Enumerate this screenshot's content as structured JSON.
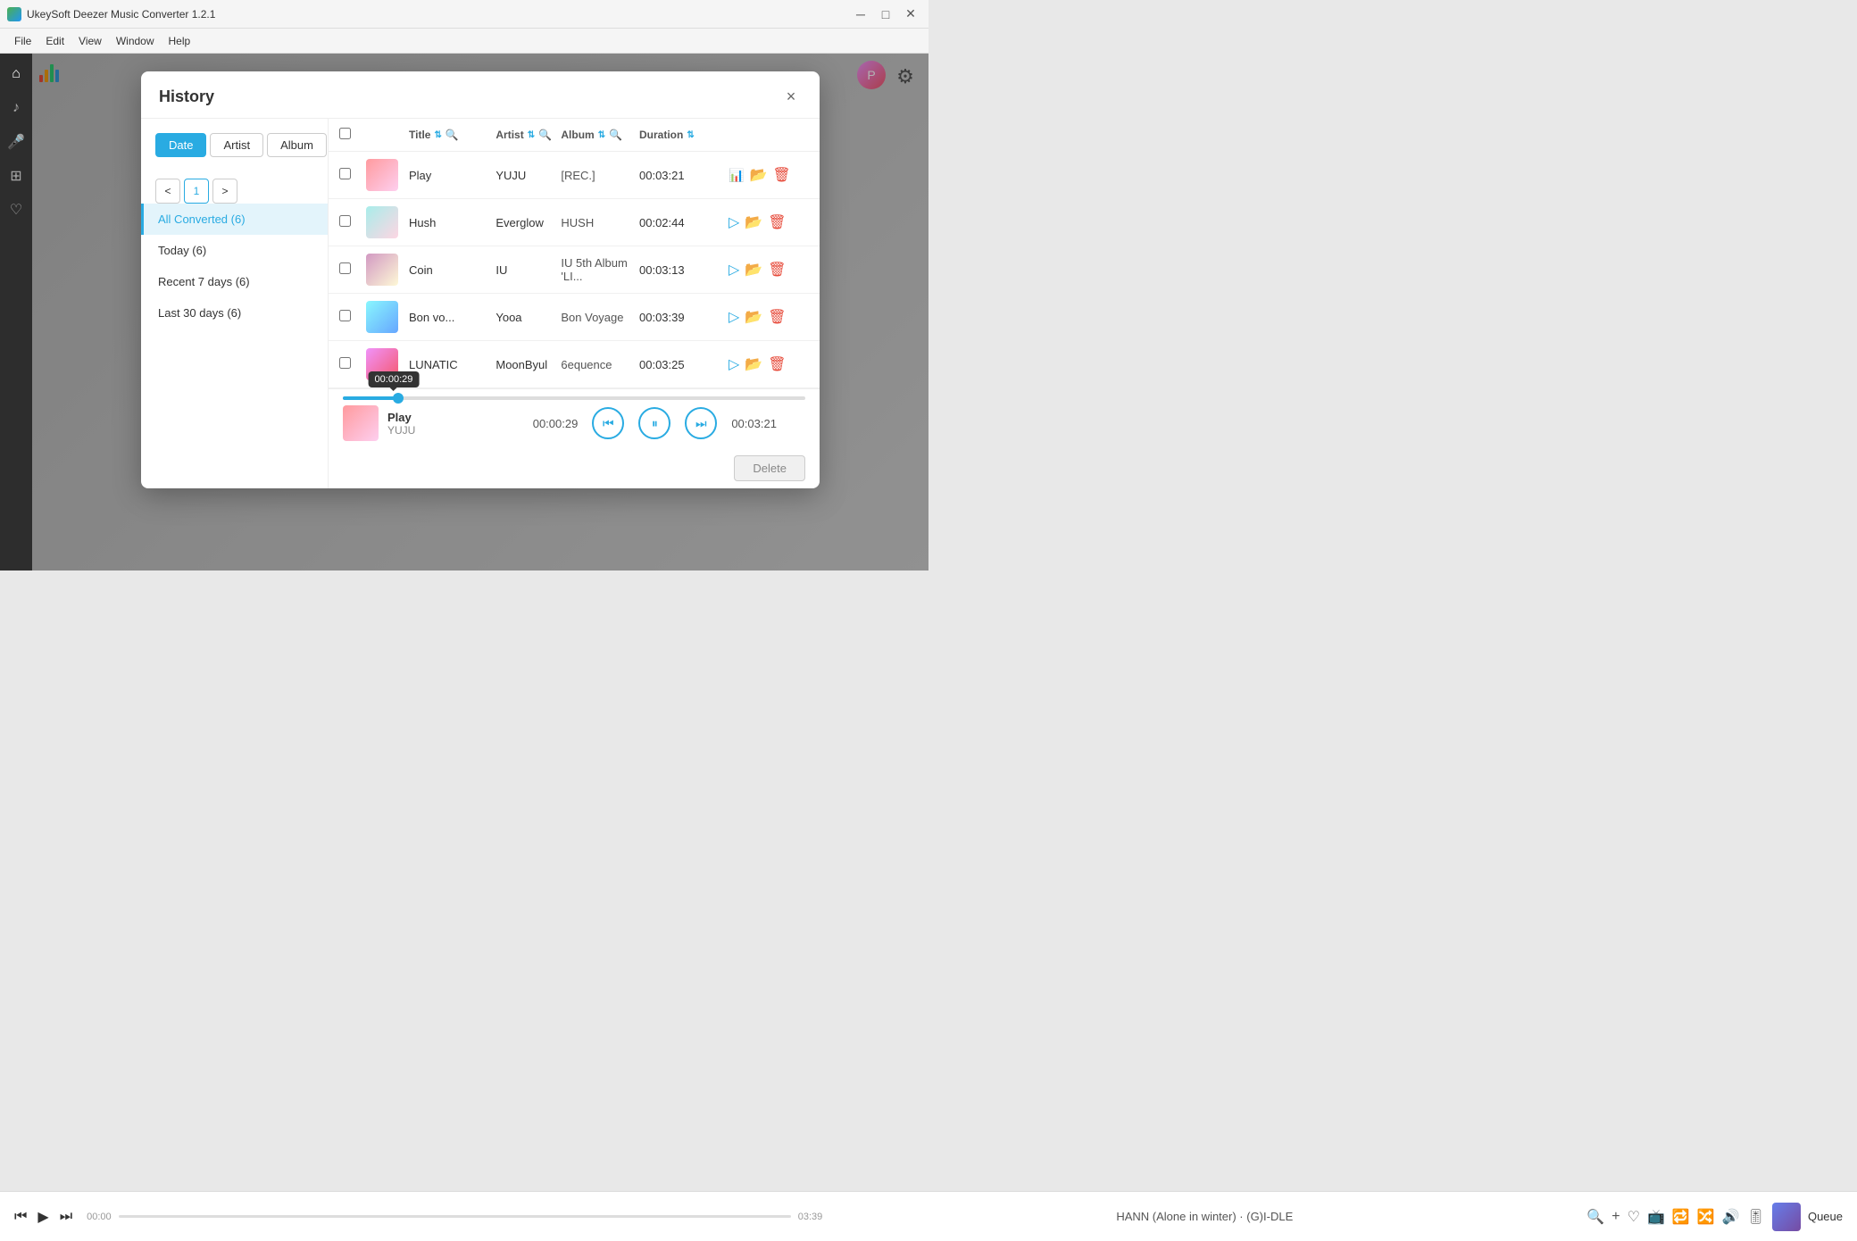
{
  "app": {
    "title": "UkeySoft Deezer Music Converter 1.2.1",
    "menu": [
      "File",
      "Edit",
      "View",
      "Window",
      "Help"
    ]
  },
  "modal": {
    "title": "History",
    "close_label": "×",
    "filter_tabs": [
      {
        "label": "Date",
        "active": true
      },
      {
        "label": "Artist",
        "active": false
      },
      {
        "label": "Album",
        "active": false
      }
    ],
    "nav_items": [
      {
        "label": "All Converted (6)",
        "active": true
      },
      {
        "label": "Today (6)",
        "active": false
      },
      {
        "label": "Recent 7 days (6)",
        "active": false
      },
      {
        "label": "Last 30 days (6)",
        "active": false
      }
    ],
    "pagination": {
      "current": "1",
      "prev": "<",
      "next": ">"
    },
    "table_headers": {
      "title": "Title",
      "artist": "Artist",
      "album": "Album",
      "duration": "Duration"
    },
    "songs": [
      {
        "id": 1,
        "title": "Play",
        "artist": "YUJU",
        "album": "[REC.]",
        "duration": "00:03:21",
        "playing": true
      },
      {
        "id": 2,
        "title": "Hush",
        "artist": "Everglow",
        "album": "HUSH",
        "duration": "00:02:44",
        "playing": false
      },
      {
        "id": 3,
        "title": "Coin",
        "artist": "IU",
        "album": "IU 5th Album 'LI...",
        "duration": "00:03:13",
        "playing": false
      },
      {
        "id": 4,
        "title": "Bon vo...",
        "artist": "Yooa",
        "album": "Bon Voyage",
        "duration": "00:03:39",
        "playing": false
      },
      {
        "id": 5,
        "title": "LUNATIC",
        "artist": "MoonByul",
        "album": "6equence",
        "duration": "00:03:25",
        "playing": false
      }
    ],
    "player": {
      "current_song": "Play",
      "current_artist": "YUJU",
      "current_time": "00:00:29",
      "total_time": "00:03:21",
      "tooltip_time": "00:00:29",
      "progress_percent": 12
    },
    "delete_button": "Delete"
  },
  "bottom_bar": {
    "track_name": "HANN (Alone in winter) · (G)I-DLE",
    "time_start": "00:00",
    "time_end": "03:39",
    "queue_label": "Queue"
  },
  "sidebar": {
    "icons": [
      "⌂",
      "♪",
      "🎤",
      "⊞",
      "♡"
    ]
  }
}
